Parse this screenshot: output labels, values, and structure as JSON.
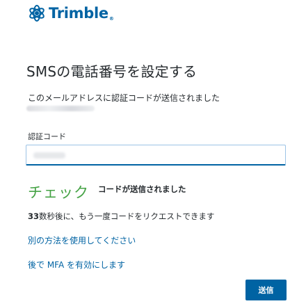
{
  "brand": {
    "name": "Trimble",
    "trademark": "®",
    "color": "#0063a3"
  },
  "page": {
    "title": "SMSの電話番号を設定する",
    "sent_message": "このメールアドレスに認証コードが送信されました"
  },
  "form": {
    "code_label": "認証コード",
    "code_value": ""
  },
  "status": {
    "check_label": "チェック",
    "check_color": "#46a346",
    "code_sent": "コードが送信されました",
    "resend_seconds": "33",
    "resend_suffix": "数秒後に、もう一度コードをリクエストできます"
  },
  "links": {
    "alternate_method": "別の方法を使用してください",
    "mfa_later": "後で MFA を有効にします"
  },
  "actions": {
    "submit_label": "送信",
    "submit_color": "#0063a3"
  }
}
